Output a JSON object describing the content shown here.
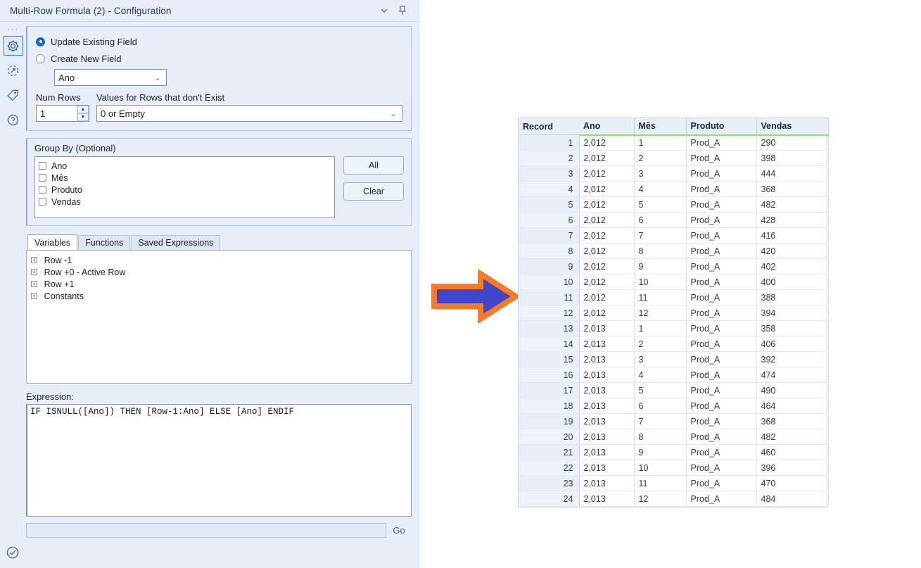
{
  "window": {
    "title": "Multi-Row Formula (2) - Configuration",
    "collapse_icon": "chevron-down-icon",
    "pin_icon": "pin-icon"
  },
  "icon_rail": {
    "dots": "···",
    "items": [
      {
        "name": "gear-icon",
        "active": true
      },
      {
        "name": "run-icon",
        "active": false
      },
      {
        "name": "tag-icon",
        "active": false
      },
      {
        "name": "help-icon",
        "active": false
      }
    ],
    "bottom_icon": "check-circle-icon"
  },
  "config": {
    "update_existing_label": "Update Existing Field",
    "create_new_label": "Create New  Field",
    "update_existing_selected": true,
    "field_value": "Ano",
    "num_rows_label": "Num Rows",
    "num_rows_value": "1",
    "values_label": "Values for Rows that don't Exist",
    "values_value": "0 or Empty",
    "group_by_label": "Group By (Optional)",
    "group_by_fields": [
      "Ano",
      "Mês",
      "Produto",
      "Vendas"
    ],
    "all_button": "All",
    "clear_button": "Clear"
  },
  "tabs": [
    {
      "label": "Variables",
      "active": true
    },
    {
      "label": "Functions",
      "active": false
    },
    {
      "label": "Saved Expressions",
      "active": false
    }
  ],
  "variables_tree": [
    "Row -1",
    "Row +0 - Active Row",
    "Row +1",
    "Constants"
  ],
  "expression": {
    "label": "Expression:",
    "text": "IF ISNULL([Ano]) THEN [Row-1:Ano] ELSE [Ano] ENDIF"
  },
  "go_bar": {
    "input_value": "",
    "button_label": "Go"
  },
  "arrow": {
    "name": "right-arrow-graphic",
    "fill_color": "#3f47c8",
    "stroke_color": "#f97b22"
  },
  "results_table": {
    "columns": [
      "Record",
      "Ano",
      "Mês",
      "Produto",
      "Vendas"
    ],
    "header_underline_color": "#8ee06a",
    "rows": [
      [
        "1",
        "2,012",
        "1",
        "Prod_A",
        "290"
      ],
      [
        "2",
        "2,012",
        "2",
        "Prod_A",
        "398"
      ],
      [
        "3",
        "2,012",
        "3",
        "Prod_A",
        "444"
      ],
      [
        "4",
        "2,012",
        "4",
        "Prod_A",
        "368"
      ],
      [
        "5",
        "2,012",
        "5",
        "Prod_A",
        "482"
      ],
      [
        "6",
        "2,012",
        "6",
        "Prod_A",
        "428"
      ],
      [
        "7",
        "2,012",
        "7",
        "Prod_A",
        "416"
      ],
      [
        "8",
        "2,012",
        "8",
        "Prod_A",
        "420"
      ],
      [
        "9",
        "2,012",
        "9",
        "Prod_A",
        "402"
      ],
      [
        "10",
        "2,012",
        "10",
        "Prod_A",
        "400"
      ],
      [
        "11",
        "2,012",
        "11",
        "Prod_A",
        "388"
      ],
      [
        "12",
        "2,012",
        "12",
        "Prod_A",
        "394"
      ],
      [
        "13",
        "2,013",
        "1",
        "Prod_A",
        "358"
      ],
      [
        "14",
        "2,013",
        "2",
        "Prod_A",
        "406"
      ],
      [
        "15",
        "2,013",
        "3",
        "Prod_A",
        "392"
      ],
      [
        "16",
        "2,013",
        "4",
        "Prod_A",
        "474"
      ],
      [
        "17",
        "2,013",
        "5",
        "Prod_A",
        "490"
      ],
      [
        "18",
        "2,013",
        "6",
        "Prod_A",
        "464"
      ],
      [
        "19",
        "2,013",
        "7",
        "Prod_A",
        "368"
      ],
      [
        "20",
        "2,013",
        "8",
        "Prod_A",
        "482"
      ],
      [
        "21",
        "2,013",
        "9",
        "Prod_A",
        "460"
      ],
      [
        "22",
        "2,013",
        "10",
        "Prod_A",
        "396"
      ],
      [
        "23",
        "2,013",
        "11",
        "Prod_A",
        "470"
      ],
      [
        "24",
        "2,013",
        "12",
        "Prod_A",
        "484"
      ]
    ]
  }
}
